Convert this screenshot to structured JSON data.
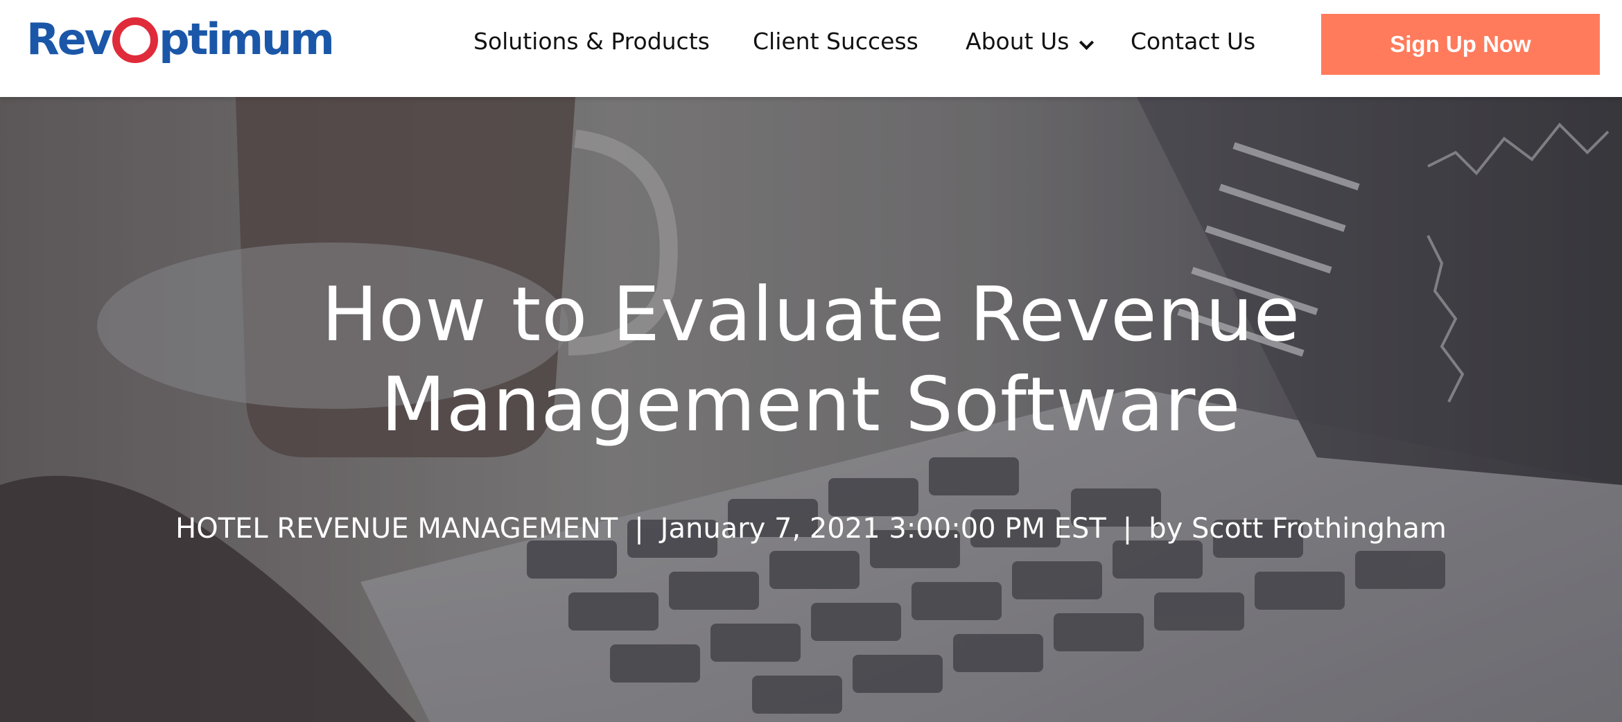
{
  "header": {
    "logo": {
      "part1": "Rev",
      "part2": "ptimum",
      "brand_colors": {
        "blue": "#1b57a8",
        "red": "#e02b3a"
      }
    },
    "nav": [
      {
        "label": "Solutions & Products"
      },
      {
        "label": "Client Success"
      },
      {
        "label": "About Us",
        "has_dropdown": true
      },
      {
        "label": "Contact Us"
      }
    ],
    "cta": {
      "label": "Sign Up Now",
      "color": "#ff7b5c"
    }
  },
  "hero": {
    "title_line1": "How to Evaluate Revenue",
    "title_line2": "Management Software",
    "category": "HOTEL REVENUE MANAGEMENT",
    "separator": "|",
    "date": "January 7, 2021 3:00:00 PM EST",
    "author": "by Scott Frothingham"
  }
}
